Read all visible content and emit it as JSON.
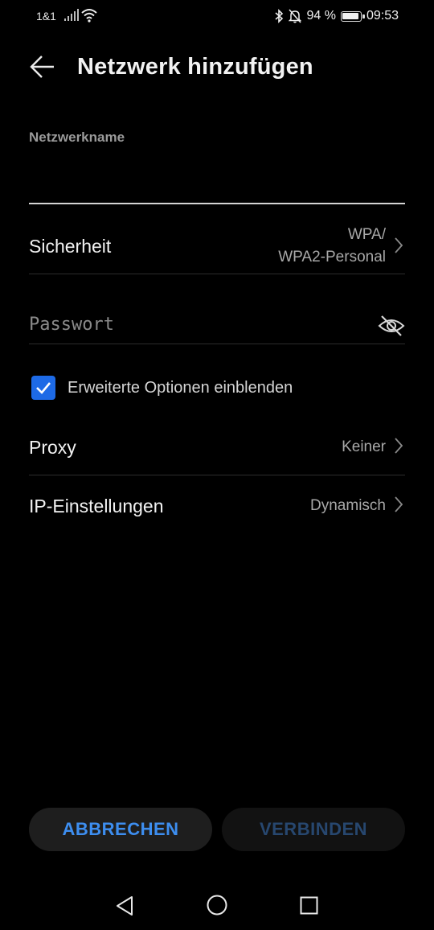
{
  "status_bar": {
    "carrier": "1&1",
    "battery_percent": "94 %",
    "battery_level": 0.94,
    "time": "09:53",
    "icons": [
      "signal-icon",
      "wifi-icon",
      "bluetooth-icon",
      "bell-off-icon",
      "battery-icon"
    ]
  },
  "app_bar": {
    "title": "Netzwerk hinzufügen",
    "back_icon": "arrow-left-icon"
  },
  "form": {
    "network_name": {
      "label": "Netzwerkname",
      "value": ""
    },
    "security": {
      "label": "Sicherheit",
      "value_line1": "WPA/",
      "value_line2": "WPA2-Personal"
    },
    "password": {
      "placeholder": "Passwort",
      "visibility_icon": "eye-off-icon"
    },
    "advanced": {
      "label": "Erweiterte Optionen einblenden",
      "checked": true
    },
    "proxy": {
      "label": "Proxy",
      "value": "Keiner"
    },
    "ip_settings": {
      "label": "IP-Einstellungen",
      "value": "Dynamisch"
    }
  },
  "buttons": {
    "cancel": "ABBRECHEN",
    "connect": "VERBINDEN"
  },
  "colors": {
    "accent": "#1d6ae6",
    "cancel_text": "#3d8ef0",
    "connect_disabled_text": "#27476f",
    "background": "#000000"
  },
  "nav_bar": [
    "nav-back-icon",
    "nav-home-icon",
    "nav-recents-icon"
  ]
}
